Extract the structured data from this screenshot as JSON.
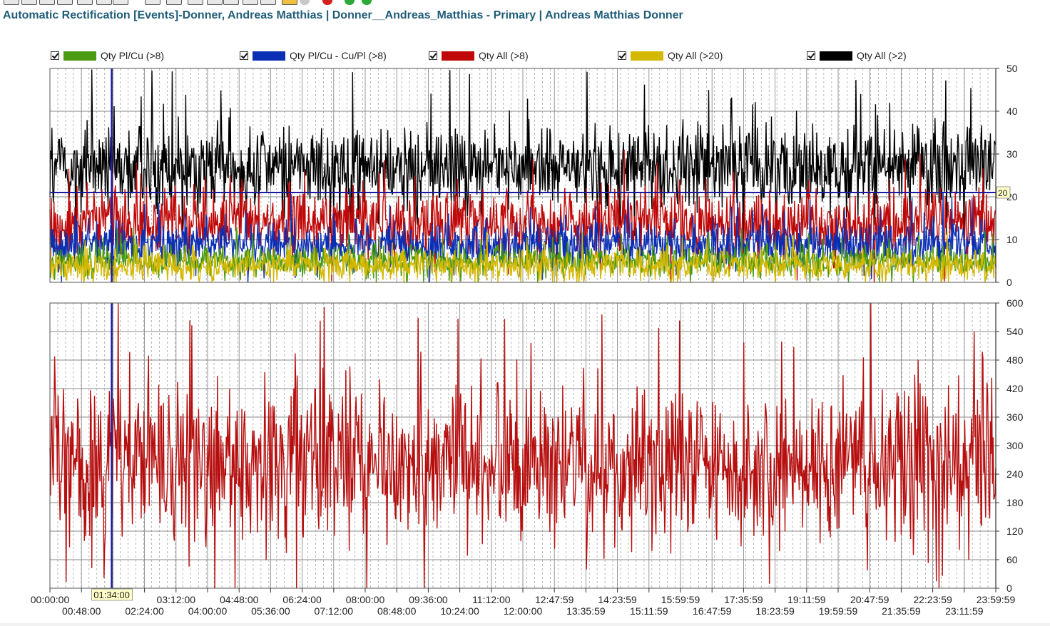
{
  "window": {
    "title": "Automatic Rectification [Events]-Donner, Andreas Matthias | Donner__Andreas_Matthias - Primary | Andreas Matthias Donner"
  },
  "toolbar": {
    "icons": [
      "table-icon",
      "table-icon",
      "table-icon",
      "table-icon",
      "table-icon",
      "page-icon",
      "page-icon",
      "page-icon",
      "page-icon",
      "page-icon",
      "page-icon",
      "chart-icon",
      "color-icon",
      "page-icon",
      "highlight-icon",
      "circle-icon",
      "stop-icon",
      "refresh-icon",
      "go-icon"
    ]
  },
  "legend": [
    {
      "label": "Qty Pl/Cu (>8)",
      "color": "#4a9a12",
      "checked": true
    },
    {
      "label": "Qty Pl/Cu - Cu/Pl (>8)",
      "color": "#0a2fb4",
      "checked": true
    },
    {
      "label": "Qty All (>8)",
      "color": "#c00808",
      "checked": true
    },
    {
      "label": "Qty All (>20)",
      "color": "#d4b800",
      "checked": true
    },
    {
      "label": "Qty All (>2)",
      "color": "#000000",
      "checked": true
    }
  ],
  "chart_data": [
    {
      "type": "line",
      "name_hint": "upper",
      "ylim": [
        0,
        50
      ],
      "y_ticks": [
        "0",
        "10",
        "20",
        "30",
        "40",
        "50"
      ],
      "threshold_line": {
        "value": 21,
        "label": "20",
        "color": "#1a1aa0"
      },
      "cursor_time": "01:34:00",
      "series": [
        {
          "name": "Qty All (>2)",
          "color": "#000000",
          "mean": 27,
          "min_typical": 17,
          "max_typical": 40
        },
        {
          "name": "Qty All (>8)",
          "color": "#c00808",
          "mean": 14,
          "min_typical": 6,
          "max_typical": 24
        },
        {
          "name": "Qty Pl/Cu - Cu/Pl (>8)",
          "color": "#0a2fb4",
          "mean": 9,
          "min_typical": 4,
          "max_typical": 16
        },
        {
          "name": "Qty Pl/Cu (>8)",
          "color": "#4a9a12",
          "mean": 5,
          "min_typical": 1,
          "max_typical": 9
        },
        {
          "name": "Qty All (>20)",
          "color": "#d4b800",
          "mean": 4,
          "min_typical": 0,
          "max_typical": 8
        }
      ]
    },
    {
      "type": "line",
      "name_hint": "lower",
      "ylim": [
        0,
        600
      ],
      "y_ticks": [
        "0",
        "60",
        "120",
        "180",
        "240",
        "300",
        "360",
        "420",
        "480",
        "540",
        "600"
      ],
      "cursor_time": "01:34:00",
      "series": [
        {
          "color": "#b70f0f",
          "mean": 262,
          "min_typical": 120,
          "max_typical": 480
        }
      ]
    }
  ],
  "x_axis": {
    "labels_top": [
      "00:00:00",
      "01:34:00",
      "03:12:00",
      "04:48:00",
      "06:24:00",
      "08:00:00",
      "09:36:00",
      "11:12:00",
      "12:47:59",
      "14:23:59",
      "15:59:59",
      "17:35:59",
      "19:11:59",
      "20:47:59",
      "22:23:59",
      "23:59:59"
    ],
    "labels_bottom": [
      "00:48:00",
      "02:24:00",
      "04:00:00",
      "05:36:00",
      "07:12:00",
      "08:48:00",
      "10:24:00",
      "12:00:00",
      "13:35:59",
      "15:11:59",
      "16:47:59",
      "18:23:59",
      "19:59:59",
      "21:35:59",
      "23:11:59"
    ]
  },
  "cursor_label": "01:34:00"
}
